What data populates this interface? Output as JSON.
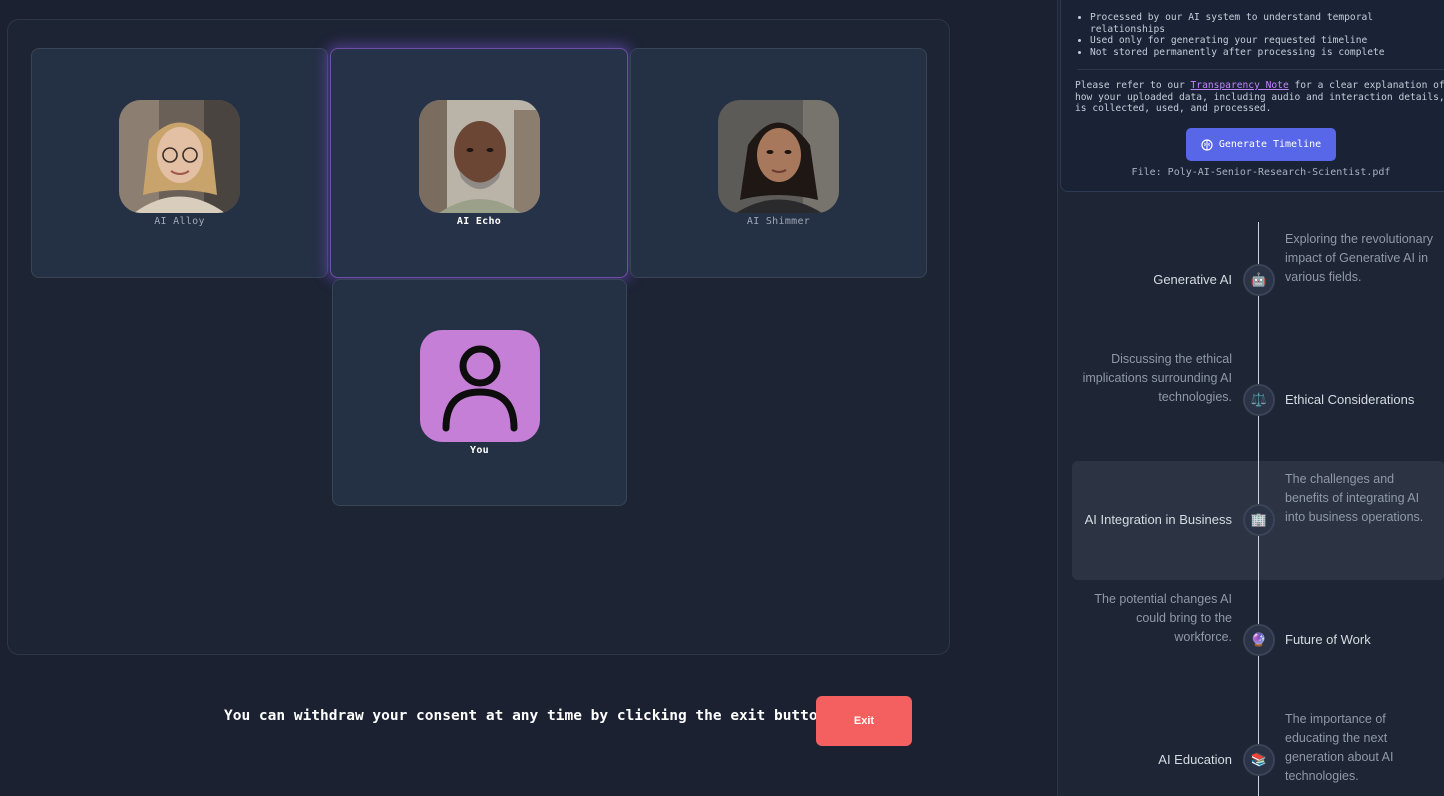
{
  "participants": [
    {
      "name": "AI Alloy",
      "active": false
    },
    {
      "name": "AI Echo",
      "active": true
    },
    {
      "name": "AI Shimmer",
      "active": false
    },
    {
      "name": "You",
      "active": false
    }
  ],
  "consent": {
    "message": "You can withdraw your consent at any time by clicking the exit button",
    "exit_label": "Exit",
    "exit_color": "#f46060"
  },
  "info": {
    "bullets": [
      "Processed by our AI system to understand temporal relationships",
      "Used only for generating your requested timeline",
      "Not stored permanently after processing is complete"
    ],
    "note_prefix": "Please refer to our ",
    "note_link": "Transparency Note",
    "note_suffix": " for a clear explanation of how your uploaded data, including audio and interaction details, is collected, used, and processed.",
    "generate_label": "Generate Timeline",
    "file_label": "File: Poly-AI-Senior-Research-Scientist.pdf",
    "accent": "#5866e8"
  },
  "timeline": [
    {
      "title": "Generative AI",
      "description": "Exploring the revolutionary impact of Generative AI in various fields.",
      "icon": "robot-icon",
      "glyph": "🤖",
      "title_side": "left"
    },
    {
      "title": "Ethical Considerations",
      "description": "Discussing the ethical implications surrounding AI technologies.",
      "icon": "scales-icon",
      "glyph": "⚖️",
      "title_side": "right"
    },
    {
      "title": "AI Integration in Business",
      "description": "The challenges and benefits of integrating AI into business operations.",
      "icon": "office-building-icon",
      "glyph": "🏢",
      "title_side": "left"
    },
    {
      "title": "Future of Work",
      "description": "The potential changes AI could bring to the workforce.",
      "icon": "crystal-ball-icon",
      "glyph": "🔮",
      "title_side": "right"
    },
    {
      "title": "AI Education",
      "description": "The importance of educating the next generation about AI technologies.",
      "icon": "books-icon",
      "glyph": "📚",
      "title_side": "left"
    }
  ]
}
